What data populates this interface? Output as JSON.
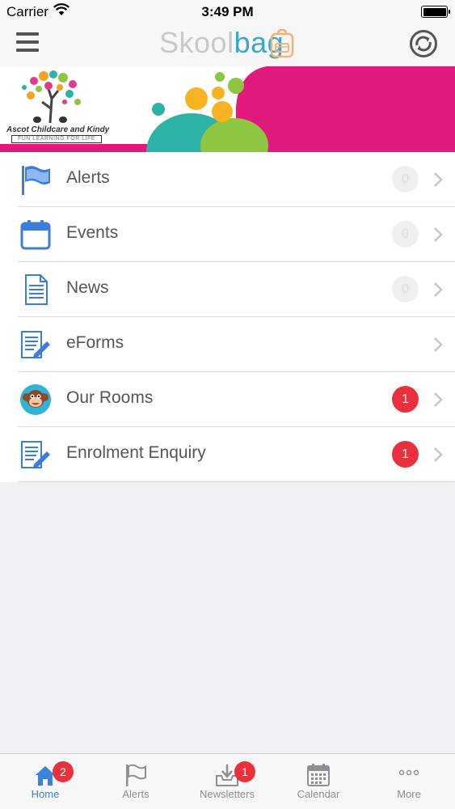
{
  "status_bar": {
    "carrier": "Carrier",
    "time": "3:49 PM"
  },
  "header": {
    "logo_part1": "Skool",
    "logo_part2": "bag",
    "menu_icon": "hamburger-icon",
    "refresh_icon": "refresh-icon"
  },
  "banner": {
    "school_name": "Ascot Childcare and Kindy",
    "tagline": "FUN LEARNING FOR LIFE"
  },
  "menu": {
    "items": [
      {
        "label": "Alerts",
        "icon": "flag-icon",
        "badge": "0"
      },
      {
        "label": "Events",
        "icon": "calendar-icon",
        "badge": "0"
      },
      {
        "label": "News",
        "icon": "document-icon",
        "badge": "0"
      },
      {
        "label": "eForms",
        "icon": "form-pencil-icon"
      },
      {
        "label": "Our Rooms",
        "icon": "monkey-icon",
        "badge": "1"
      },
      {
        "label": "Enrolment Enquiry",
        "icon": "form-pencil-icon",
        "badge": "1"
      }
    ]
  },
  "tab_bar": {
    "tabs": [
      {
        "label": "Home",
        "icon": "home-icon",
        "badge": "2",
        "active": true
      },
      {
        "label": "Alerts",
        "icon": "flag-icon"
      },
      {
        "label": "Newsletters",
        "icon": "inbox-download-icon",
        "badge": "1"
      },
      {
        "label": "Calendar",
        "icon": "calendar-icon"
      },
      {
        "label": "More",
        "icon": "more-dots-icon"
      }
    ]
  },
  "colors": {
    "accent_blue": "#3b83d8",
    "logo_blue": "#3aa6c8",
    "badge_red": "#e9303d",
    "banner_pink": "#df1a7c"
  }
}
